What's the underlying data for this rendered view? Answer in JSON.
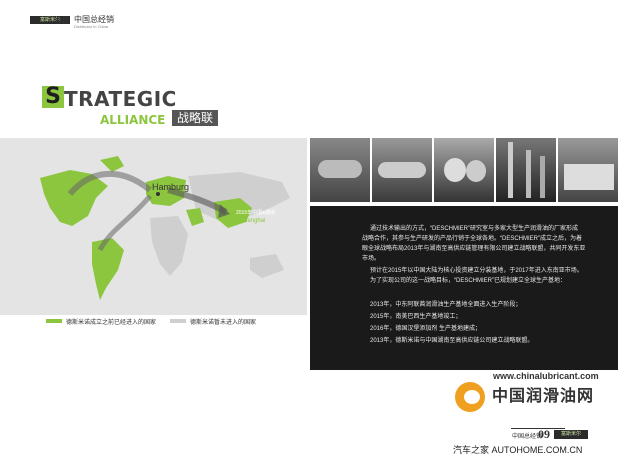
{
  "header": {
    "brand": "富斯米尔",
    "page_number": "08",
    "title": "中国总经销",
    "subtitle": "Distributor in China"
  },
  "heading": {
    "initial": "S",
    "rest": "TRATEGIC",
    "alliance": "ALLIANCE",
    "chinese": "战略联盟"
  },
  "map": {
    "hamburg": "Hamburg",
    "shanghai": "Shanghai",
    "china_label": "2015年中国●湖南"
  },
  "legend": [
    {
      "color": "#8cc63f",
      "label": "德斯米诺成立之前已经进入的国家"
    },
    {
      "color": "#cfcfcf",
      "label": "德斯米诺暂未进入的国家"
    }
  ],
  "photos": [
    "industrial-plant-1",
    "industrial-plant-2",
    "storage-tanks",
    "refinery-towers",
    "factory-building"
  ],
  "body": {
    "p1": [
      "通过技术输出的方式，“DESCHMIER”研究室与多家大型生产润滑油的厂家形成",
      "战略合作，其参与生产研发的产品行销于全球各地。“DESCHMIER”成立之后，为着",
      "眼全球战略布局2013年与湖南至高供应链管理有限公司建立战略联盟，共同开发东亚",
      "市场。"
    ],
    "p2": [
      "预计在2015年以中国大陆为核心投资建立分装基地，于2017年进入东南亚市场。",
      "为了实现公司的这一战略目标，“DESCHMIER”已规划建立全球生产基地："
    ],
    "timeline": [
      "2013年，中东阿联酋润滑油生产基地全面进入生产阶段；",
      "2015年，南美巴西生产基地竣工；",
      "2016年，德国汉堡添加剂 生产基地建成；",
      "2013年，德斯米诺与中国湖南至高供应链公司建立战略联盟。"
    ]
  },
  "footer": {
    "url": "www.chinalubricant.com",
    "site_name": "中国润滑油网",
    "distributor": "中国总经销",
    "page_number": "09",
    "brand": "富斯米尔",
    "watermark": "汽车之家 AUTOHOME.COM.CN"
  }
}
